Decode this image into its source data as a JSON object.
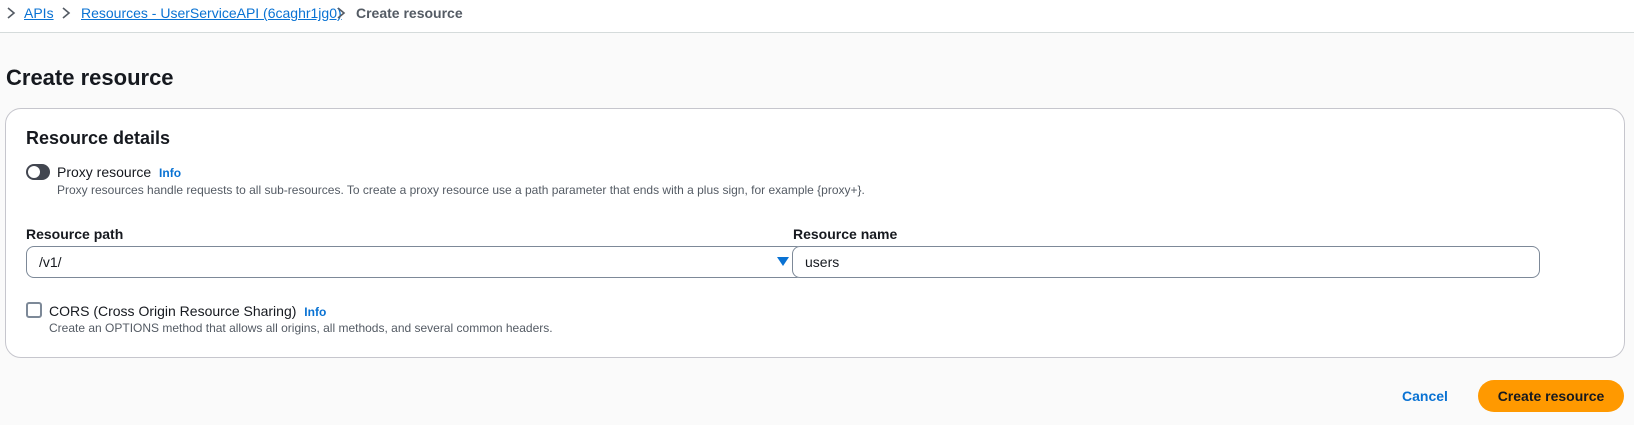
{
  "breadcrumb": {
    "items": [
      {
        "label": "APIs"
      },
      {
        "label": "Resources - UserServiceAPI (6caghr1jg0)"
      },
      {
        "label": "Create resource"
      }
    ]
  },
  "page": {
    "title": "Create resource"
  },
  "panel": {
    "title": "Resource details",
    "proxy": {
      "label": "Proxy resource",
      "info": "Info",
      "description": "Proxy resources handle requests to all sub-resources. To create a proxy resource use a path parameter that ends with a plus sign, for example {proxy+}."
    },
    "resource_path": {
      "label": "Resource path",
      "value": "/v1/"
    },
    "resource_name": {
      "label": "Resource name",
      "value": "users"
    },
    "cors": {
      "label": "CORS (Cross Origin Resource Sharing)",
      "info": "Info",
      "description": "Create an OPTIONS method that allows all origins, all methods, and several common headers."
    }
  },
  "actions": {
    "cancel": "Cancel",
    "create": "Create resource"
  },
  "colors": {
    "link": "#0972d3",
    "primary_button": "#ff9900"
  }
}
